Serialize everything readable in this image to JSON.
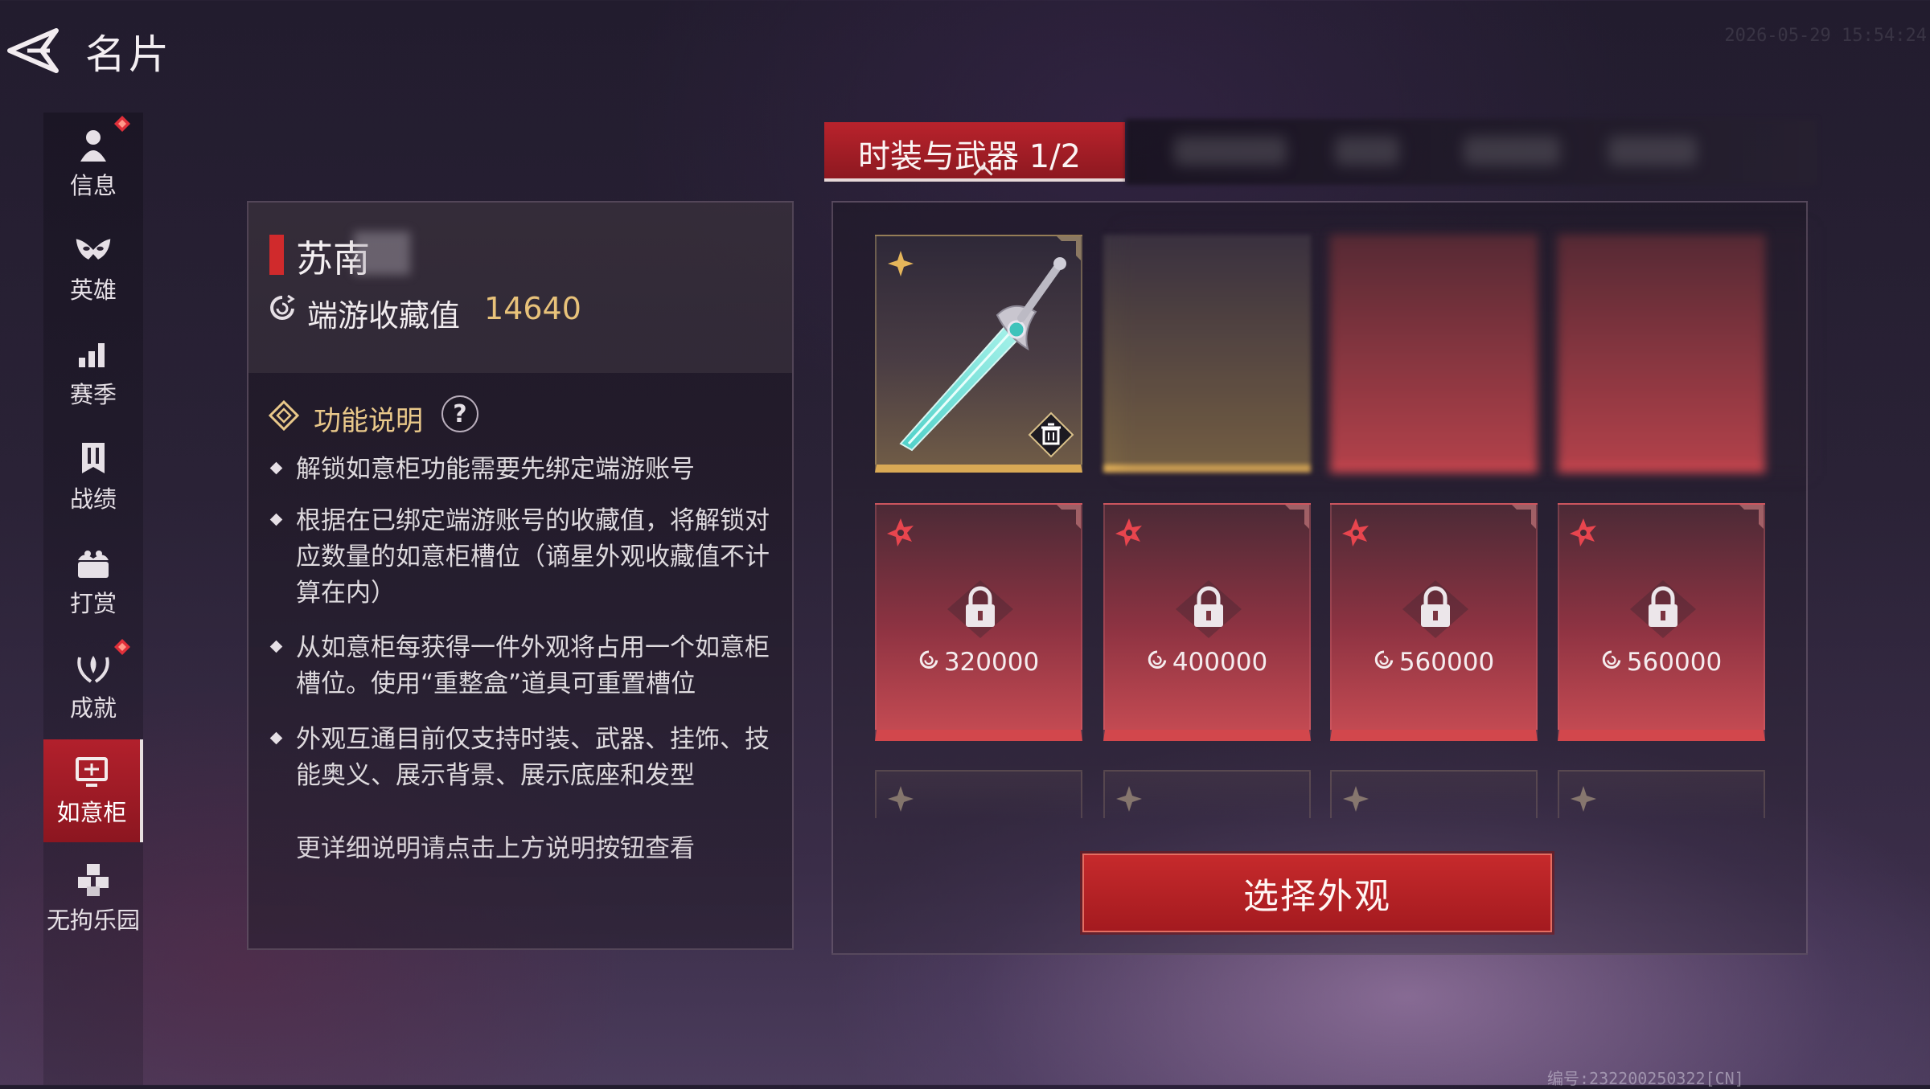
{
  "header": {
    "title": "名片",
    "timestamp": "2026-05-29 15:54:24"
  },
  "sidebar": {
    "items": [
      {
        "label": "信息",
        "icon": "person-icon",
        "badge": true
      },
      {
        "label": "英雄",
        "icon": "hero-mask-icon",
        "badge": false
      },
      {
        "label": "赛季",
        "icon": "bar-chart-icon",
        "badge": false
      },
      {
        "label": "战绩",
        "icon": "banner-icon",
        "badge": false
      },
      {
        "label": "打赏",
        "icon": "gift-icon",
        "badge": false
      },
      {
        "label": "成就",
        "icon": "laurel-icon",
        "badge": true
      },
      {
        "label": "如意柜",
        "icon": "cabinet-icon",
        "badge": false,
        "active": true
      },
      {
        "label": "无拘乐园",
        "icon": "blocks-icon",
        "badge": false
      }
    ]
  },
  "profile": {
    "name": "苏南",
    "collection_label": "端游收藏值",
    "collection_value": "14640"
  },
  "info": {
    "title": "功能说明",
    "help_label": "?",
    "items": [
      "解锁如意柜功能需要先绑定端游账号",
      "根据在已绑定端游账号的收藏值，将解锁对应数量的如意柜槽位（谪星外观收藏值不计算在内）",
      "从如意柜每获得一件外观将占用一个如意柜槽位。使用“重整盒”道具可重置槽位",
      "外观互通目前仅支持时装、武器、挂饰、技能奥义、展示背景、展示底座和发型"
    ],
    "more_note": "更详细说明请点击上方说明按钮查看"
  },
  "tabs": {
    "active_label": "时装与武器 1/2"
  },
  "slots": {
    "locked_costs": [
      "320000",
      "400000",
      "560000",
      "560000"
    ]
  },
  "actions": {
    "select_label": "选择外观"
  },
  "footer": {
    "code": "编号:232200250322[CN]"
  },
  "colors": {
    "accent_red": "#b9232c",
    "gold": "#d9a955",
    "value_gold": "#e8c27a"
  }
}
